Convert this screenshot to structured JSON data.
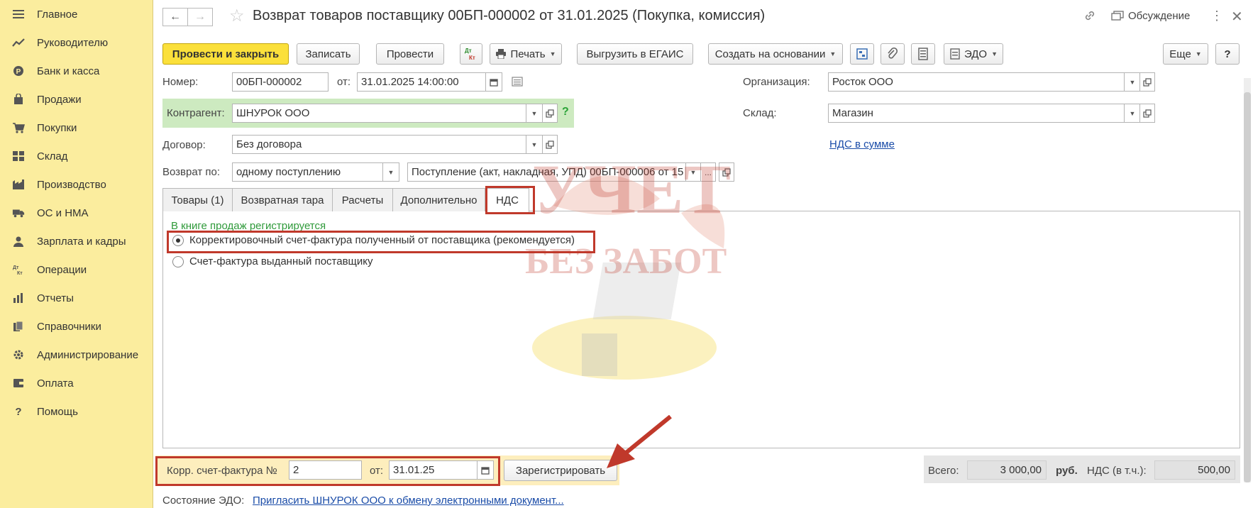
{
  "sidebar": {
    "items": [
      {
        "label": "Главное",
        "icon": "menu-icon"
      },
      {
        "label": "Руководителю",
        "icon": "trend-icon"
      },
      {
        "label": "Банк и касса",
        "icon": "coin-icon"
      },
      {
        "label": "Продажи",
        "icon": "bag-icon"
      },
      {
        "label": "Покупки",
        "icon": "cart-icon"
      },
      {
        "label": "Склад",
        "icon": "warehouse-icon"
      },
      {
        "label": "Производство",
        "icon": "factory-icon"
      },
      {
        "label": "ОС и НМА",
        "icon": "truck-icon"
      },
      {
        "label": "Зарплата и кадры",
        "icon": "person-icon"
      },
      {
        "label": "Операции",
        "icon": "dt-kt-icon"
      },
      {
        "label": "Отчеты",
        "icon": "chart-icon"
      },
      {
        "label": "Справочники",
        "icon": "books-icon"
      },
      {
        "label": "Администрирование",
        "icon": "gear-icon"
      },
      {
        "label": "Оплата",
        "icon": "wallet-icon"
      },
      {
        "label": "Помощь",
        "icon": "question-icon"
      }
    ]
  },
  "header": {
    "title": "Возврат товаров поставщику 00БП-000002 от 31.01.2025 (Покупка, комиссия)",
    "discuss_label": "Обсуждение"
  },
  "toolbar": {
    "post_close": "Провести и закрыть",
    "save": "Записать",
    "post": "Провести",
    "dt_kt": "Дт Кт",
    "print": "Печать",
    "egais": "Выгрузить в ЕГАИС",
    "create_based": "Создать на основании",
    "edo": "ЭДО",
    "more": "Еще",
    "help": "?"
  },
  "form": {
    "number_label": "Номер:",
    "number_value": "00БП-000002",
    "date_label": "от:",
    "date_value": "31.01.2025 14:00:00",
    "org_label": "Организация:",
    "org_value": "Росток ООО",
    "contractor_label": "Контрагент:",
    "contractor_value": "ШНУРОК ООО",
    "warehouse_label": "Склад:",
    "warehouse_value": "Магазин",
    "contract_label": "Договор:",
    "contract_value": "Без договора",
    "vat_link": "НДС в сумме",
    "return_label": "Возврат по:",
    "return_value": "одному поступлению",
    "receipt_value": "Поступление (акт, накладная, УПД) 00БП-000006 от 15",
    "receipt_more": "..."
  },
  "tabs": [
    {
      "label": "Товары (1)"
    },
    {
      "label": "Возвратная тара"
    },
    {
      "label": "Расчеты"
    },
    {
      "label": "Дополнительно"
    },
    {
      "label": "НДС"
    }
  ],
  "vat_tab": {
    "section_title": "В книге продаж регистрируется",
    "option1": "Корректировочный счет-фактура полученный от поставщика (рекомендуется)",
    "option2": "Счет-фактура выданный поставщику",
    "selected": 1
  },
  "bottom": {
    "corr_label": "Корр. счет-фактура №",
    "corr_number": "2",
    "corr_date_label": "от:",
    "corr_date": "31.01.25",
    "register_btn": "Зарегистрировать",
    "total_label": "Всего:",
    "total_value": "3 000,00",
    "currency": "руб.",
    "vat_label": "НДС (в т.ч.):",
    "vat_value": "500,00",
    "edo_label": "Состояние ЭДО:",
    "edo_link": "Пригласить ШНУРОК ООО к обмену электронными документ..."
  },
  "watermark": {
    "line1": "УЧЕТ",
    "line2": "БЕЗ ЗАБОТ"
  },
  "colors": {
    "sidebar_bg": "#fbed9e",
    "primary_btn": "#fbe03b",
    "highlight_frame": "#c0392b",
    "section_green": "#2f9a3a",
    "link": "#1a4ca8"
  }
}
